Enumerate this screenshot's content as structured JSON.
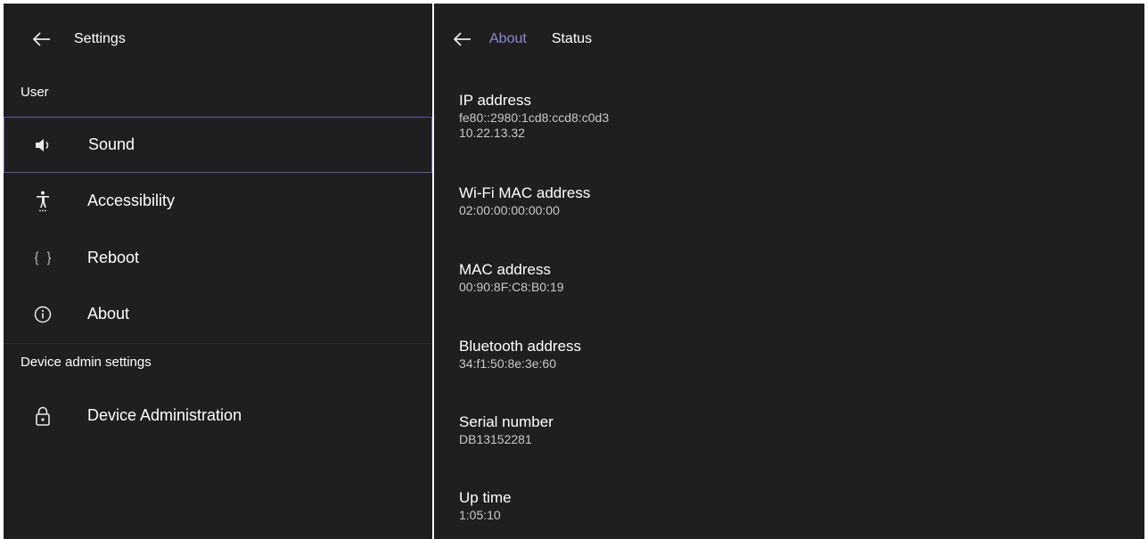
{
  "settings_pane": {
    "title": "Settings",
    "sections": [
      {
        "header": "User"
      },
      {
        "header": "Device admin settings"
      }
    ],
    "items": [
      {
        "label": "Sound",
        "icon": "speaker-icon",
        "selected": true
      },
      {
        "label": "Accessibility",
        "icon": "accessibility-icon"
      },
      {
        "label": "Reboot",
        "icon": "braces-icon"
      },
      {
        "label": "About",
        "icon": "info-icon"
      },
      {
        "label": "Device Administration",
        "icon": "lock-icon"
      }
    ]
  },
  "status_pane": {
    "breadcrumb_parent": "About",
    "breadcrumb_current": "Status",
    "fields": [
      {
        "label": "IP address",
        "values": [
          "fe80::2980:1cd8:ccd8:c0d3",
          "10.22.13.32"
        ]
      },
      {
        "label": "Wi-Fi MAC address",
        "values": [
          "02:00:00:00:00:00"
        ]
      },
      {
        "label": "MAC address",
        "values": [
          "00:90:8F:C8:B0:19"
        ]
      },
      {
        "label": "Bluetooth address",
        "values": [
          "34:f1:50:8e:3e:60"
        ]
      },
      {
        "label": "Serial number",
        "values": [
          "DB13152281"
        ]
      },
      {
        "label": "Up time",
        "values": [
          "1:05:10"
        ]
      }
    ]
  },
  "colors": {
    "background": "#201f1f",
    "accent": "#8b88d6",
    "selection_border": "#5d5a9e"
  }
}
